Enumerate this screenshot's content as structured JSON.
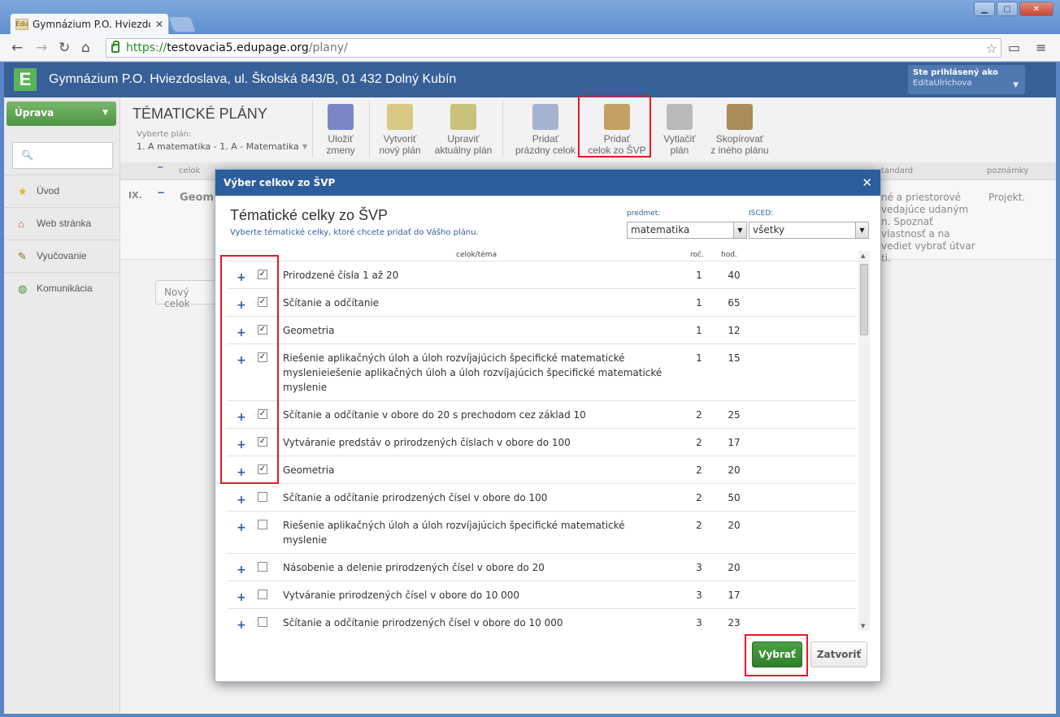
{
  "browser": {
    "tab_title": "Gymnázium P.O. Hviezdos",
    "tab_favicon": "Edu",
    "url_scheme": "https://",
    "url_host": "testovacia5.edupage.org",
    "url_path": "/plany/"
  },
  "header": {
    "logo_letter": "E",
    "school_name": "Gymnázium P.O. Hviezdoslava, ul. Školská 843/B, 01 432 Dolný Kubín",
    "login_label": "Ste prihlásený ako",
    "login_user": "EditaUlrichova"
  },
  "sidebar": {
    "primary_button": "Úprava",
    "items": [
      {
        "label": "Úvod",
        "icon": "star-icon"
      },
      {
        "label": "Web stránka",
        "icon": "house-icon"
      },
      {
        "label": "Vyučovanie",
        "icon": "chalk-icon"
      },
      {
        "label": "Komunikácia",
        "icon": "globe-icon"
      }
    ]
  },
  "main": {
    "title": "TÉMATICKÉ PLÁNY",
    "plan_label": "Vyberte plán:",
    "plan_value": "1. A matematika - 1. A - Matematika",
    "tools": [
      {
        "line1": "Uložiť",
        "line2": "zmeny"
      },
      {
        "line1": "Vytvoriť",
        "line2": "nový plán"
      },
      {
        "line1": "Upraviť",
        "line2": "aktuálny plán"
      },
      {
        "line1": "Pridať",
        "line2": "prázdny celok"
      },
      {
        "line1": "Pridať",
        "line2": "celok zo ŠVP"
      },
      {
        "line1": "Vytlačiť",
        "line2": "plán"
      },
      {
        "line1": "Skopírovať",
        "line2": "z iného plánu"
      }
    ],
    "table": {
      "col_celok": "celok",
      "col_standard": "tandard",
      "col_poznamky": "poznámky",
      "row_month": "IX.",
      "row_name": "Geom",
      "row_text_lines": [
        "né a priestorové",
        "vedajúce udaným",
        "n.   Spoznať",
        "vlastnosť a na",
        "vediet vybrať útvar",
        "ti."
      ],
      "row_note": "Projekt.",
      "new_unit_button": "Nový celok"
    }
  },
  "modal": {
    "header": "Výber celkov zo ŠVP",
    "title": "Tématické celky zo ŠVP",
    "subtitle": "Vyberte tématické celky, ktoré chcete pridať do Vášho plánu.",
    "predmet_label": "predmet:",
    "predmet_value": "matematika",
    "isced_label": "ISCED:",
    "isced_value": "všetky",
    "col_topic": "celok/téma",
    "col_roc": "roč.",
    "col_hod": "hod.",
    "rows": [
      {
        "name": "Prirodzené čísla 1 až 20",
        "roc": "1",
        "hod": "40",
        "checked": true
      },
      {
        "name": "Sčítanie a odčítanie",
        "roc": "1",
        "hod": "65",
        "checked": true
      },
      {
        "name": "Geometria",
        "roc": "1",
        "hod": "12",
        "checked": true
      },
      {
        "name": "Riešenie aplikačných úloh a úloh rozvíjajúcich špecifické matematické myslenieiešenie aplikačných úloh a úloh rozvíjajúcich špecifické matematické myslenie",
        "roc": "1",
        "hod": "15",
        "checked": true
      },
      {
        "name": "Sčítanie a odčítanie v obore do 20 s prechodom cez základ 10",
        "roc": "2",
        "hod": "25",
        "checked": true
      },
      {
        "name": "Vytváranie predstáv o prirodzených číslach v obore do 100",
        "roc": "2",
        "hod": "17",
        "checked": true
      },
      {
        "name": "Geometria",
        "roc": "2",
        "hod": "20",
        "checked": true
      },
      {
        "name": "Sčítanie a odčítanie prirodzených čísel v obore do 100",
        "roc": "2",
        "hod": "50",
        "checked": false
      },
      {
        "name": "Riešenie aplikačných úloh a úloh rozvíjajúcich špecifické matematické myslenie",
        "roc": "2",
        "hod": "20",
        "checked": false
      },
      {
        "name": "Násobenie a delenie prirodzených čísel v obore do 20",
        "roc": "3",
        "hod": "20",
        "checked": false
      },
      {
        "name": "Vytváranie prirodzených čísel v obore do 10 000",
        "roc": "3",
        "hod": "17",
        "checked": false
      },
      {
        "name": "Sčítanie a odčítanie prirodzených čísel v obore do 10 000",
        "roc": "3",
        "hod": "23",
        "checked": false
      }
    ],
    "btn_select": "Vybrať",
    "btn_close": "Zatvoriť"
  },
  "colors": {
    "accent_blue": "#2c5d9c",
    "highlight_red": "#e21b23",
    "green": "#3d8f37"
  }
}
